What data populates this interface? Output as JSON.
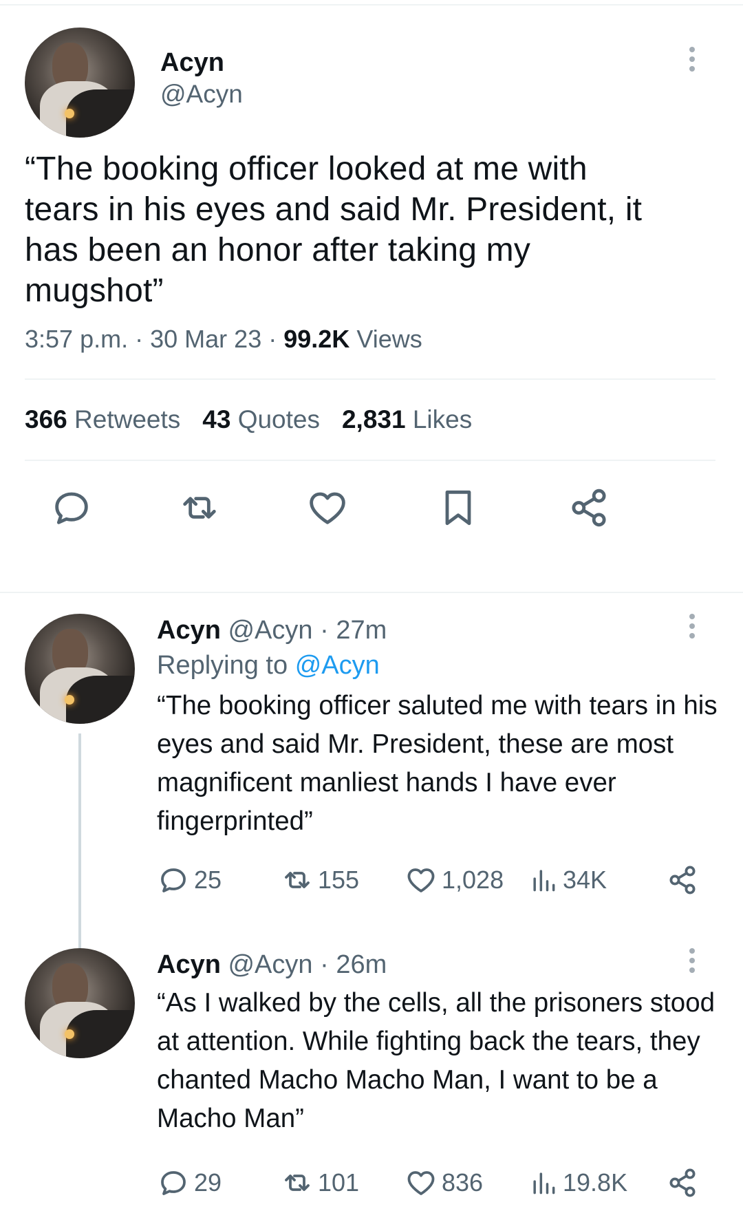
{
  "main_tweet": {
    "name": "Acyn",
    "handle": "@Acyn",
    "text": "“The booking officer looked at me with tears in his eyes and said Mr. President, it has been an honor after taking my mugshot”",
    "time": "3:57 p.m.",
    "separator": "·",
    "date": "30 Mar 23",
    "views_count": "99.2K",
    "views_label": "Views",
    "retweets_count": "366",
    "retweets_label": "Retweets",
    "quotes_count": "43",
    "quotes_label": "Quotes",
    "likes_count": "2,831",
    "likes_label": "Likes",
    "icons": [
      "reply-icon",
      "retweet-icon",
      "like-icon",
      "bookmark-icon",
      "share-icon"
    ]
  },
  "replies": [
    {
      "name": "Acyn",
      "handle": "@Acyn",
      "separator": "·",
      "time": "27m",
      "replying_label": "Replying to",
      "replying_to": "@Acyn",
      "text": "“The booking officer saluted me with tears in his eyes and said Mr. President, these are most magnificent manliest hands I have ever fingerprinted”",
      "reply_count": "25",
      "retweet_count": "155",
      "like_count": "1,028",
      "view_count": "34K"
    },
    {
      "name": "Acyn",
      "handle": "@Acyn",
      "separator": "·",
      "time": "26m",
      "text": "“As I walked by the cells, all the prisoners stood at attention. While fighting back the tears, they chanted Macho Macho Man, I want to be a Macho Man”",
      "reply_count": "29",
      "retweet_count": "101",
      "like_count": "836",
      "view_count": "19.8K"
    }
  ],
  "colors": {
    "text": "#0f1419",
    "muted": "#536471",
    "link": "#1d9bf0",
    "divider": "#eff3f4"
  }
}
